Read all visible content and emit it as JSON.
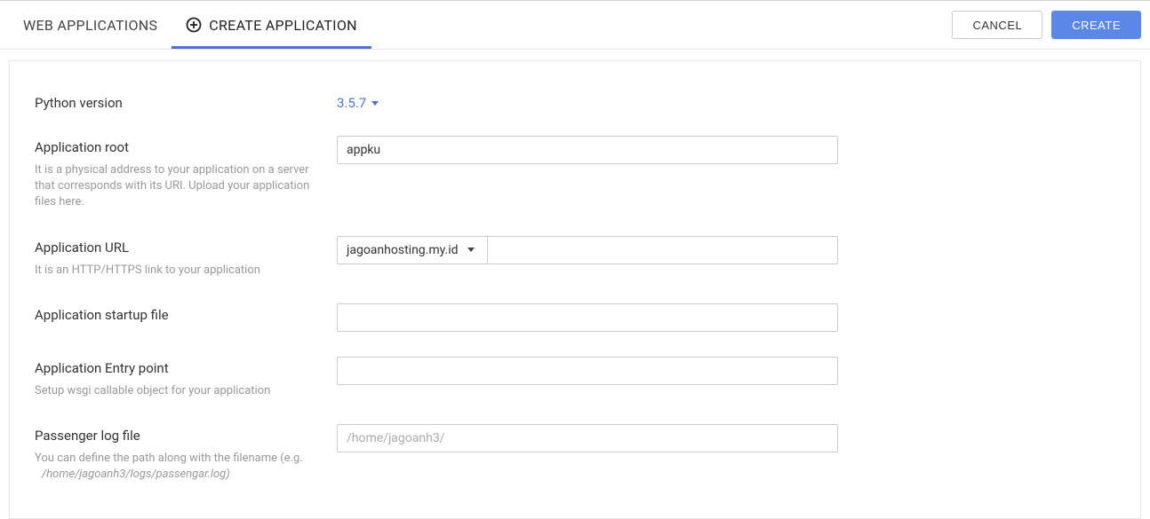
{
  "tabs": {
    "web_applications": "WEB APPLICATIONS",
    "create_application": "CREATE APPLICATION"
  },
  "actions": {
    "cancel": "CANCEL",
    "create": "CREATE"
  },
  "form": {
    "python_version": {
      "label": "Python version",
      "value": "3.5.7"
    },
    "app_root": {
      "label": "Application root",
      "help": "It is a physical address to your application on a server that corresponds with its URI. Upload your application files here.",
      "value": "appku"
    },
    "app_url": {
      "label": "Application URL",
      "help": "It is an HTTP/HTTPS link to your application",
      "domain": "jagoanhosting.my.id",
      "path": ""
    },
    "startup_file": {
      "label": "Application startup file",
      "value": ""
    },
    "entry_point": {
      "label": "Application Entry point",
      "help": "Setup wsgi callable object for your application",
      "value": ""
    },
    "passenger_log": {
      "label": "Passenger log file",
      "help_line1": "You can define the path along with the filename (e.g.",
      "help_line2": "/home/jagoanh3/logs/passengar.log)",
      "placeholder": "/home/jagoanh3/",
      "value": ""
    }
  }
}
